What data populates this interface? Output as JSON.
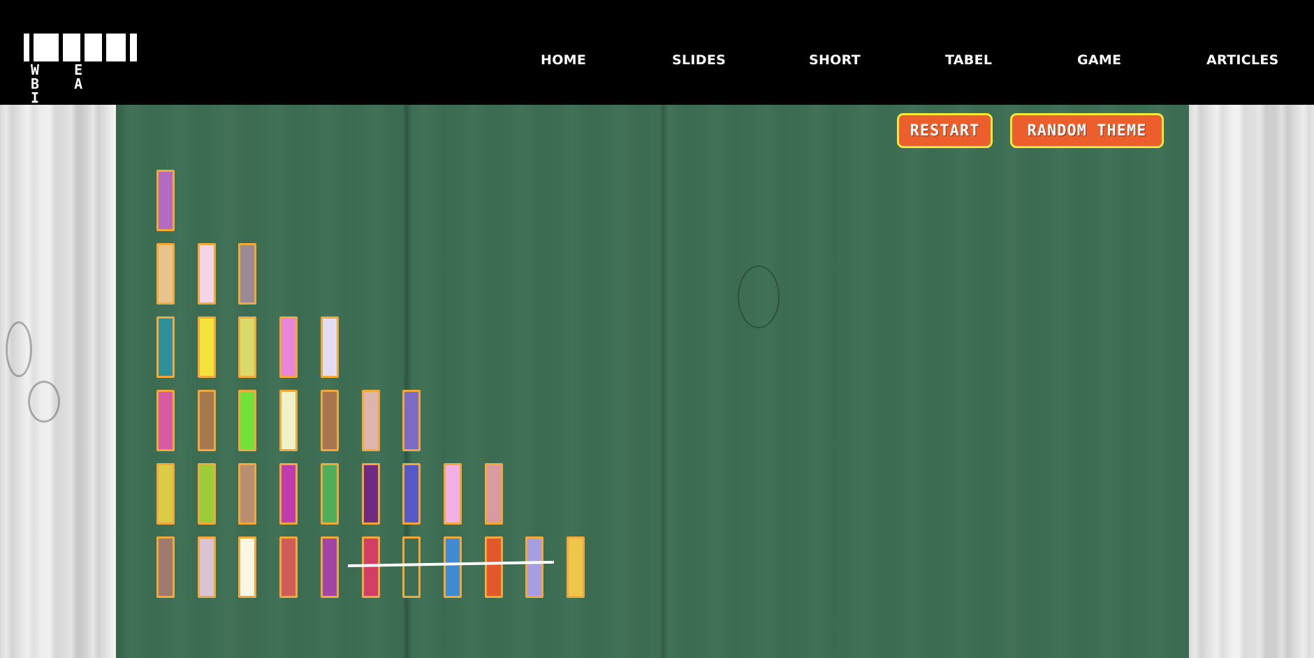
{
  "logo": {
    "text": "W E B A I"
  },
  "nav": {
    "items": [
      {
        "label": "HOME"
      },
      {
        "label": "SLIDES"
      },
      {
        "label": "SHORT"
      },
      {
        "label": "TABEL"
      },
      {
        "label": "GAME"
      },
      {
        "label": "ARTICLES"
      }
    ]
  },
  "controls": {
    "restart_label": "RESTART",
    "theme_label": "RANDOM THEME",
    "button_color": "#ec5f2c",
    "button_border_color": "#f5ea3a"
  },
  "board": {
    "color": "#3d6e53",
    "stick_border_color": "#f2a93b",
    "rows": [
      [
        "#b36bc0"
      ],
      [
        "#e8c38e",
        "#f3d4e9",
        "#9a8a94"
      ],
      [
        "#2e9199",
        "#f5e23a",
        "#dada6a",
        "#ea86d9",
        "#e3dcf2"
      ],
      [
        "#d65ba2",
        "#a67a4e",
        "#72e23a",
        "#f1f2c8",
        "#a8754f",
        "#deb5ad",
        "#7b6bc4"
      ],
      [
        "#dbcc45",
        "#9ccc3a",
        "#b89070",
        "#c03bad",
        "#50ad59",
        "#6e2b7f",
        "#5758c8",
        "#f3b0e4",
        "#d99aa2"
      ],
      [
        "#9f7b6e",
        "#d9c3d4",
        "#fbf7e4",
        "#cf5c56",
        "#a044a5",
        "#d23e66",
        "#3d6e53",
        "#3f8ad0",
        "#e3572d",
        "#a59fe2",
        "#efc64c"
      ]
    ],
    "struck": {
      "row": 5,
      "from": 5,
      "to": 9
    }
  }
}
